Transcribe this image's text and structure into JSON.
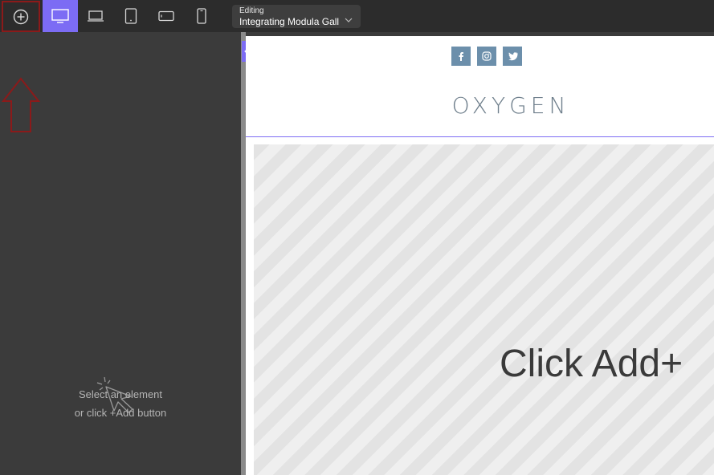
{
  "toolbar": {
    "add_icon": "plus-circle-icon",
    "devices": [
      {
        "name": "desktop-icon",
        "active": true
      },
      {
        "name": "laptop-icon",
        "active": false
      },
      {
        "name": "tablet-icon",
        "active": false
      },
      {
        "name": "tablet-landscape-icon",
        "active": false
      },
      {
        "name": "mobile-icon",
        "active": false
      }
    ],
    "editing_label": "Editing",
    "editing_value": "Integrating Modula Gall"
  },
  "sidebar": {
    "empty_line1": "Select an element",
    "empty_line2": "or click +Add button"
  },
  "canvas": {
    "social": [
      "facebook-icon",
      "instagram-icon",
      "twitter-icon"
    ],
    "logo_text": "OXYGEN",
    "placeholder_text": "Click Add+"
  },
  "colors": {
    "accent": "#7c6cf4",
    "annotation": "#8b1a1a",
    "social": "#6c8fab"
  }
}
